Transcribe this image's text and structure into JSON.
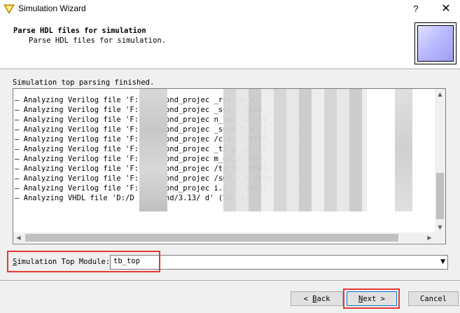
{
  "window": {
    "title": "Simulation Wizard",
    "help_label": "?",
    "close_label": "✕",
    "colors": {
      "highlight": "#e53935",
      "header_graphic": "#b8b8ff"
    }
  },
  "header": {
    "title": "Parse HDL files for simulation",
    "subtitle": "Parse HDL files for simulation."
  },
  "status": {
    "text": "Simulation top parsing finished."
  },
  "log": {
    "lines": [
      "— Analyzing Verilog file 'F:  _diamond_projec                        _rst  le.v'",
      "— Analyzing Verilog file 'F:  _diamond_projec                        _spi  ' (VER",
      "— Analyzing Verilog file 'F:  _diamond_projec                        n_smu   .v' (V",
      "— Analyzing Verilog file 'F:  _diamond_projec                        _sens   f.v' (",
      "— Analyzing Verilog file 'F:  _diamond_projec                        /clk_   ' (VER",
      "— Analyzing Verilog file 'F:  _diamond_projec                        _tx_p   .v' (V",
      "— Analyzing Verilog file 'F:  _diamond_projec                        m_dp_3   /ebr_",
      "— Analyzing Verilog file 'F:  _diamond_projec                        /tb_to   (VERI-",
      "— Analyzing Verilog file 'F:  _diamond_projec                        /smu_s   f_debu",
      "— Analyzing Verilog file 'F:  _diamond_projec                        i.v' (   1482)",
      "— Analyzing VHDL file 'D:/D      /diamond/3.13/                      d' (VH    31)"
    ]
  },
  "module": {
    "label_accel": "S",
    "label_rest": "imulation Top Module:",
    "value": "tb_top"
  },
  "buttons": {
    "back_arrow": "< ",
    "back_accel": "B",
    "back_rest": "ack",
    "next_accel": "N",
    "next_rest": "ext >",
    "cancel": "Cancel"
  }
}
